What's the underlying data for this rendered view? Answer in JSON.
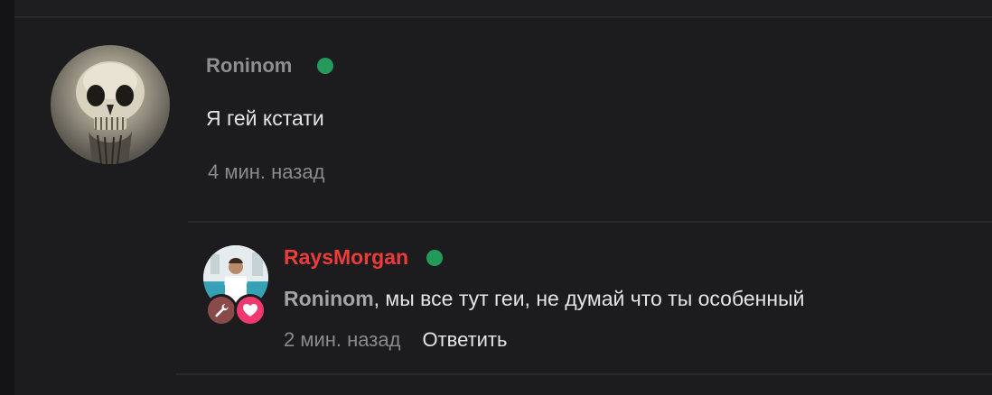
{
  "comment": {
    "author": "Roninom",
    "online": true,
    "text": "Я гей кстати",
    "time": "4 мин. назад",
    "avatar_icon": "skull-avatar"
  },
  "reply": {
    "author": "RaysMorgan",
    "online": true,
    "mention": "Roninom",
    "text": ", мы все тут геи, не думай что ты особенный",
    "time": "2 мин. назад",
    "reply_label": "Ответить",
    "badges": [
      "wrench-icon",
      "heart-icon"
    ]
  },
  "colors": {
    "background": "#1c1c1e",
    "online": "#249a5a",
    "author_highlight": "#ee3b3b",
    "heart_badge": "#f03a6f",
    "wrench_badge": "#8a4a4a"
  }
}
